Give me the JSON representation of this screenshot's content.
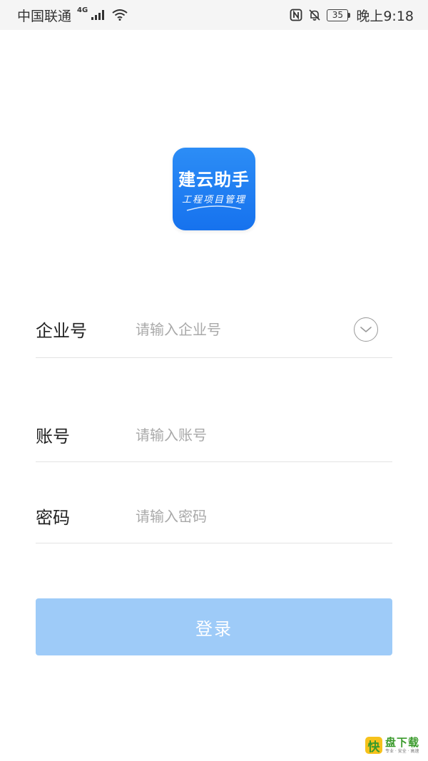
{
  "status_bar": {
    "carrier": "中国联通",
    "network_type": "4G",
    "battery_level": "35",
    "time": "晚上9:18"
  },
  "logo": {
    "title": "建云助手",
    "subtitle": "工程项目管理",
    "color": "#1f7ff2"
  },
  "form": {
    "company": {
      "label": "企业号",
      "placeholder": "请输入企业号",
      "value": ""
    },
    "account": {
      "label": "账号",
      "placeholder": "请输入账号",
      "value": ""
    },
    "password": {
      "label": "密码",
      "placeholder": "请输入密码",
      "value": ""
    }
  },
  "login_button": {
    "label": "登录",
    "color": "#9ecbf8"
  },
  "watermark": {
    "badge": "快",
    "title": "盘下载",
    "tagline": "专业 · 安全 · 高速"
  },
  "icons": [
    "signal-icon",
    "wifi-icon",
    "nfc-icon",
    "mute-icon",
    "battery-icon",
    "chevron-down-icon"
  ]
}
